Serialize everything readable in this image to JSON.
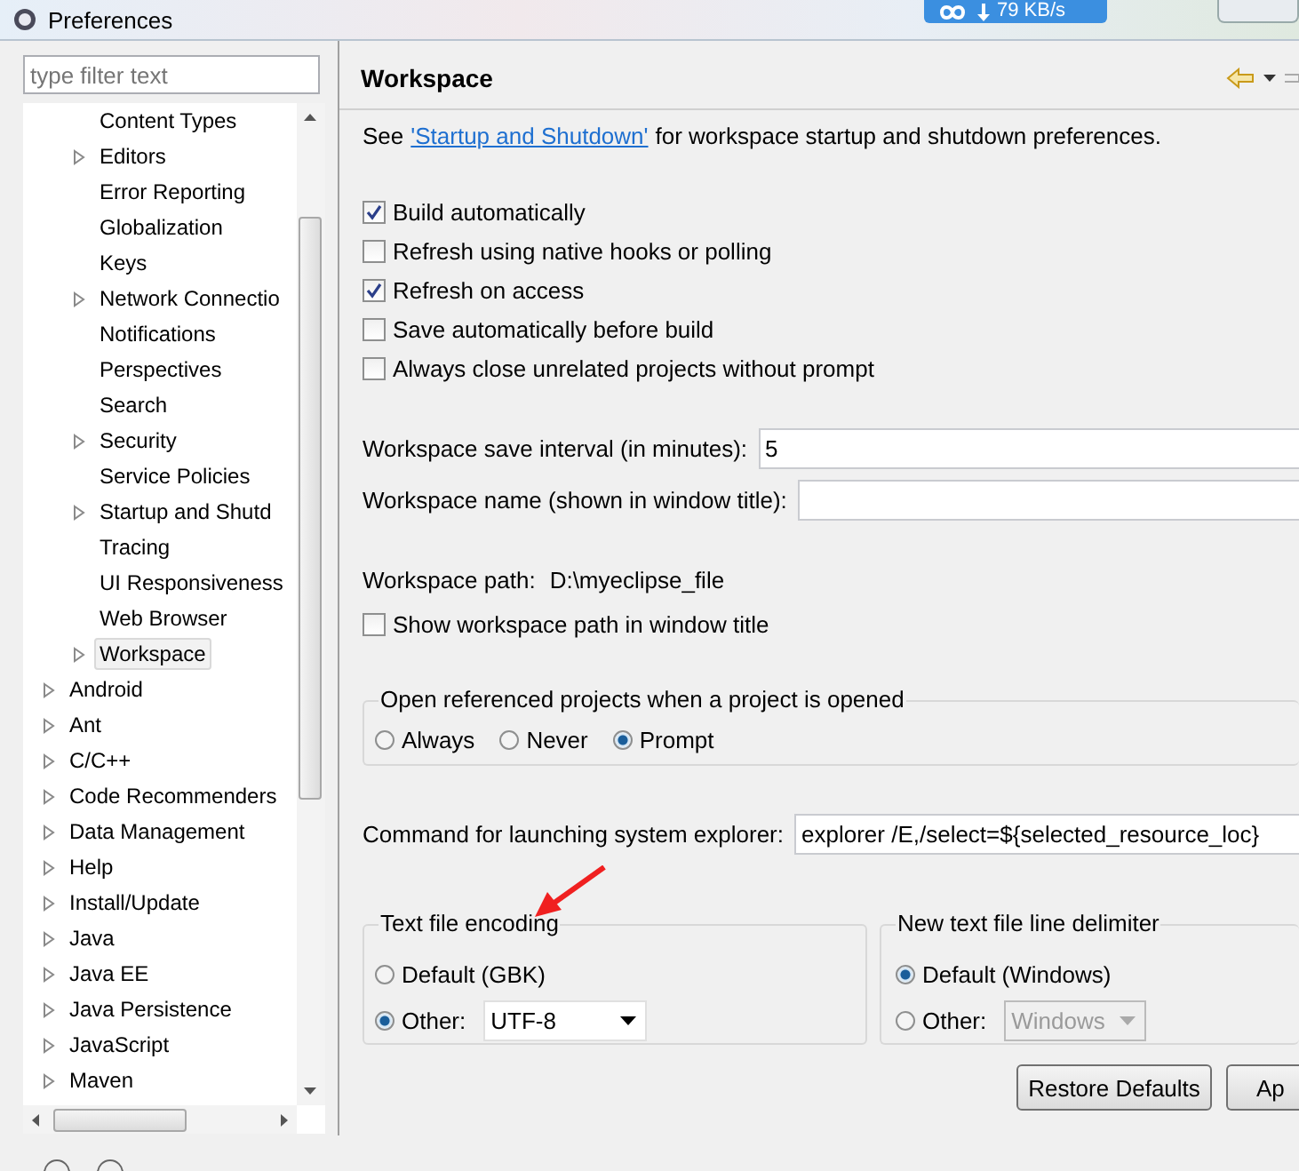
{
  "window": {
    "title": "Preferences"
  },
  "net_widget": {
    "speed": "79 KB/s"
  },
  "filter": {
    "placeholder": "type filter text"
  },
  "tree": {
    "scrolled_group": {
      "children": [
        {
          "label": "Content Types",
          "has_children": false,
          "selected": false
        },
        {
          "label": "Editors",
          "has_children": true,
          "selected": false
        },
        {
          "label": "Error Reporting",
          "has_children": false,
          "selected": false
        },
        {
          "label": "Globalization",
          "has_children": false,
          "selected": false
        },
        {
          "label": "Keys",
          "has_children": false,
          "selected": false
        },
        {
          "label": "Network Connectio",
          "has_children": true,
          "selected": false
        },
        {
          "label": "Notifications",
          "has_children": false,
          "selected": false
        },
        {
          "label": "Perspectives",
          "has_children": false,
          "selected": false
        },
        {
          "label": "Search",
          "has_children": false,
          "selected": false
        },
        {
          "label": "Security",
          "has_children": true,
          "selected": false
        },
        {
          "label": "Service Policies",
          "has_children": false,
          "selected": false
        },
        {
          "label": "Startup and Shutd",
          "has_children": true,
          "selected": false
        },
        {
          "label": "Tracing",
          "has_children": false,
          "selected": false
        },
        {
          "label": "UI Responsiveness",
          "has_children": false,
          "selected": false
        },
        {
          "label": "Web Browser",
          "has_children": false,
          "selected": false
        },
        {
          "label": "Workspace",
          "has_children": true,
          "selected": true
        }
      ]
    },
    "items": [
      {
        "label": "Android",
        "has_children": true,
        "selected": false
      },
      {
        "label": "Ant",
        "has_children": true,
        "selected": false
      },
      {
        "label": "C/C++",
        "has_children": true,
        "selected": false
      },
      {
        "label": "Code Recommenders",
        "has_children": true,
        "selected": false
      },
      {
        "label": "Data Management",
        "has_children": true,
        "selected": false
      },
      {
        "label": "Help",
        "has_children": true,
        "selected": false
      },
      {
        "label": "Install/Update",
        "has_children": true,
        "selected": false
      },
      {
        "label": "Java",
        "has_children": true,
        "selected": false
      },
      {
        "label": "Java EE",
        "has_children": true,
        "selected": false
      },
      {
        "label": "Java Persistence",
        "has_children": true,
        "selected": false
      },
      {
        "label": "JavaScript",
        "has_children": true,
        "selected": false
      },
      {
        "label": "Maven",
        "has_children": true,
        "selected": false
      }
    ]
  },
  "page": {
    "title": "Workspace",
    "intro_before": "See",
    "intro_link": "'Startup and Shutdown'",
    "intro_after": "for workspace startup and shutdown preferences.",
    "checkboxes": [
      {
        "label": "Build automatically",
        "checked": true
      },
      {
        "label": "Refresh using native hooks or polling",
        "checked": false
      },
      {
        "label": "Refresh on access",
        "checked": true
      },
      {
        "label": "Save automatically before build",
        "checked": false
      },
      {
        "label": "Always close unrelated projects without prompt",
        "checked": false
      }
    ],
    "save_interval": {
      "label": "Workspace save interval (in minutes):",
      "value": "5"
    },
    "workspace_name": {
      "label": "Workspace name (shown in window title):"
    },
    "workspace_path": {
      "label": "Workspace path:",
      "value": "D:\\myeclipse_file"
    },
    "show_path": {
      "label": "Show workspace path in window title",
      "checked": false
    },
    "open_projects": {
      "title": "Open referenced projects when a project is opened",
      "options": [
        {
          "label": "Always",
          "selected": false
        },
        {
          "label": "Never",
          "selected": false
        },
        {
          "label": "Prompt",
          "selected": true
        }
      ]
    },
    "explorer": {
      "label": "Command for launching system explorer:",
      "value": "explorer /E,/select=${selected_resource_loc}"
    },
    "encoding": {
      "title": "Text file encoding",
      "options": [
        {
          "label": "Default (GBK)",
          "selected": false
        },
        {
          "label": "Other:",
          "selected": true,
          "value": "UTF-8",
          "disabled": false
        }
      ]
    },
    "delimiter": {
      "title": "New text file line delimiter",
      "options": [
        {
          "label": "Default (Windows)",
          "selected": true
        },
        {
          "label": "Other:",
          "selected": false,
          "value": "Windows",
          "disabled": true
        }
      ]
    },
    "buttons": [
      "Restore Defaults",
      "Ap"
    ]
  }
}
